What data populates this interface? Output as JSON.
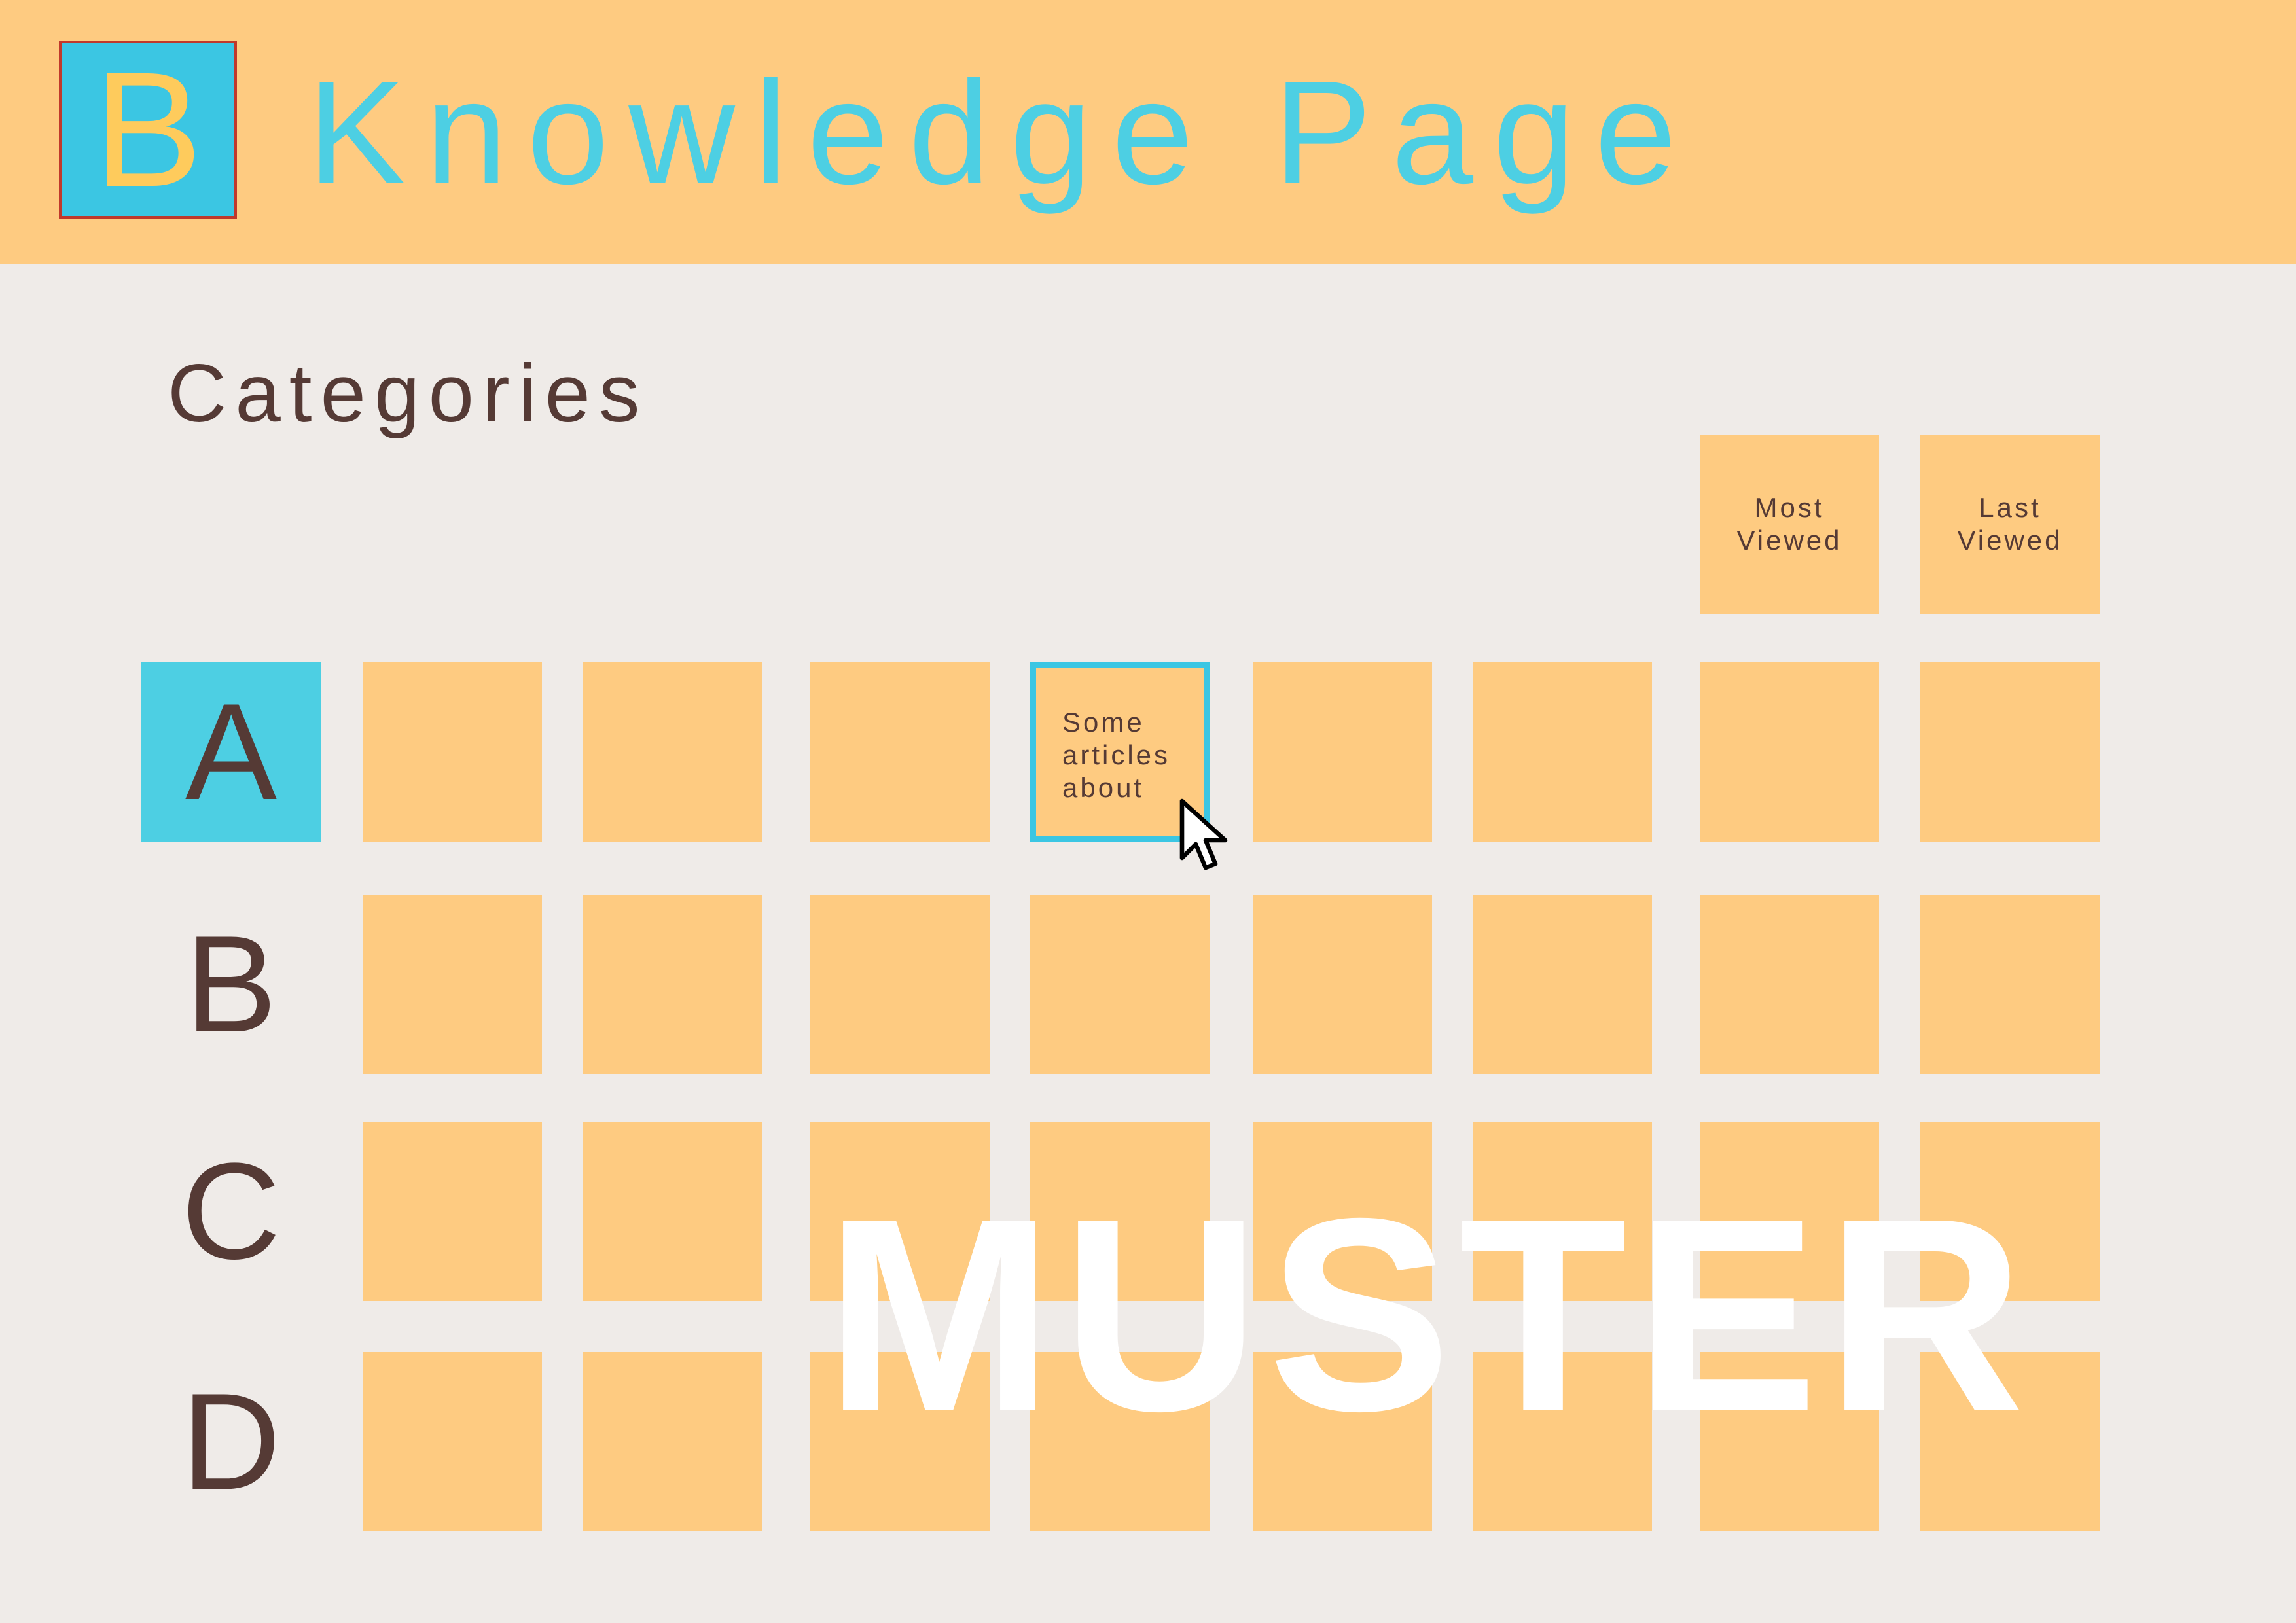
{
  "header": {
    "logo_letter": "B",
    "title": "Knowledge Page"
  },
  "main": {
    "heading": "Categories",
    "shortcuts": [
      {
        "label": "Most\nViewed"
      },
      {
        "label": "Last\nViewed"
      }
    ],
    "rows": [
      {
        "label": "A",
        "active": true,
        "selected_tile_index": 3,
        "selected_tile_text": "Some\narticles\nabout"
      },
      {
        "label": "B",
        "active": false
      },
      {
        "label": "C",
        "active": false
      },
      {
        "label": "D",
        "active": false
      }
    ],
    "tiles_per_row": 8
  },
  "watermark": "MUSTER",
  "colors": {
    "header_bg": "#fecb81",
    "page_bg": "#efebe8",
    "accent": "#4dcfe3",
    "tile": "#fecb81",
    "text": "#553a35",
    "logo_letter": "#fecb5c",
    "logo_border": "#c0392b"
  }
}
